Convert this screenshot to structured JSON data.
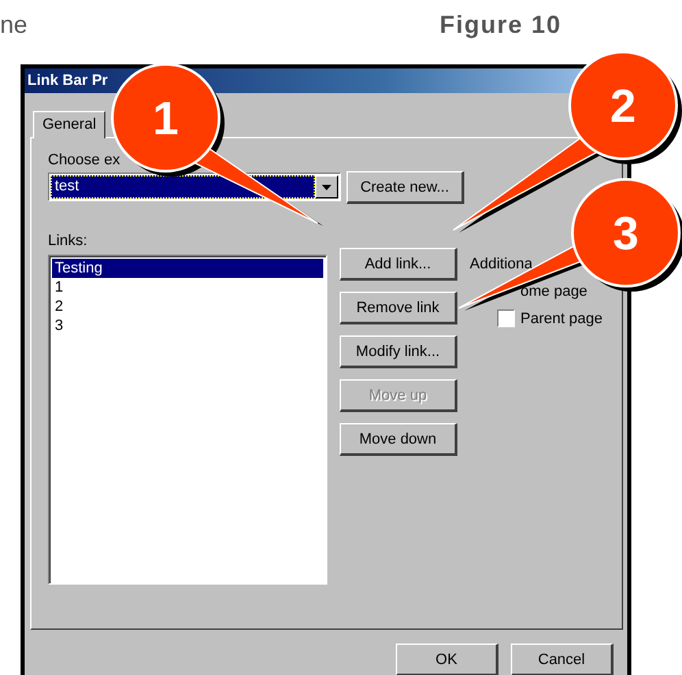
{
  "page": {
    "text_fragment": "ne",
    "figure_caption": "Figure 10"
  },
  "dialog": {
    "title": "Link Bar Pr",
    "tabs": [
      {
        "label": "General",
        "selected": true
      }
    ],
    "choose_label": "Choose ex",
    "dropdown_value": "test",
    "create_button": "Create new...",
    "links_label": "Links:",
    "links": [
      {
        "label": "Testing",
        "selected": true
      },
      {
        "label": "1",
        "selected": false
      },
      {
        "label": "2",
        "selected": false
      },
      {
        "label": "3",
        "selected": false
      }
    ],
    "buttons": [
      {
        "label": "Add link...",
        "disabled": false
      },
      {
        "label": "Remove link",
        "disabled": false
      },
      {
        "label": "Modify link...",
        "disabled": false
      },
      {
        "label": "Move up",
        "disabled": true
      },
      {
        "label": "Move down",
        "disabled": false
      }
    ],
    "additional_label": "Additiona",
    "options": [
      {
        "kind": "label",
        "label": "ome page"
      },
      {
        "kind": "checkbox",
        "label": "Parent page",
        "checked": false
      }
    ],
    "footer_buttons": [
      "OK",
      "Cancel"
    ]
  },
  "callouts": [
    {
      "number": "1"
    },
    {
      "number": "2"
    },
    {
      "number": "3"
    }
  ]
}
